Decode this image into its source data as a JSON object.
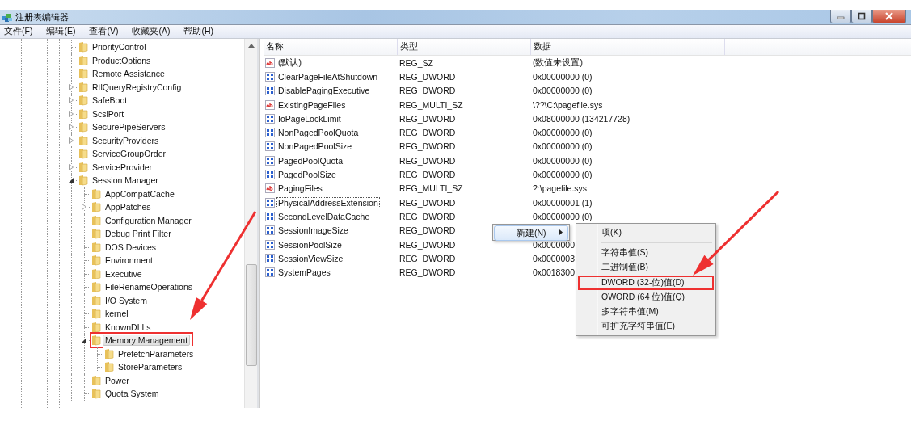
{
  "window": {
    "title": "注册表编辑器"
  },
  "menu_bar": [
    "文件(F)",
    "编辑(E)",
    "查看(V)",
    "收藏夹(A)",
    "帮助(H)"
  ],
  "tree": {
    "items": [
      {
        "label": "PriorityControl",
        "kind": "leaf",
        "selected": false,
        "marked": false
      },
      {
        "label": "ProductOptions",
        "kind": "leaf",
        "selected": false,
        "marked": false
      },
      {
        "label": "Remote Assistance",
        "kind": "leaf",
        "selected": false,
        "marked": false
      },
      {
        "label": "RtlQueryRegistryConfig",
        "kind": "collapsed",
        "selected": false,
        "marked": false
      },
      {
        "label": "SafeBoot",
        "kind": "collapsed",
        "selected": false,
        "marked": false
      },
      {
        "label": "ScsiPort",
        "kind": "collapsed",
        "selected": false,
        "marked": false
      },
      {
        "label": "SecurePipeServers",
        "kind": "collapsed",
        "selected": false,
        "marked": false
      },
      {
        "label": "SecurityProviders",
        "kind": "collapsed",
        "selected": false,
        "marked": false
      },
      {
        "label": "ServiceGroupOrder",
        "kind": "leaf",
        "selected": false,
        "marked": false
      },
      {
        "label": "ServiceProvider",
        "kind": "collapsed",
        "selected": false,
        "marked": false
      },
      {
        "label": "Session Manager",
        "kind": "expanded",
        "selected": false,
        "marked": false,
        "children": [
          {
            "label": "AppCompatCache",
            "kind": "leaf",
            "selected": false,
            "marked": false
          },
          {
            "label": "AppPatches",
            "kind": "collapsed",
            "selected": false,
            "marked": false
          },
          {
            "label": "Configuration Manager",
            "kind": "leaf",
            "selected": false,
            "marked": false
          },
          {
            "label": "Debug Print Filter",
            "kind": "leaf",
            "selected": false,
            "marked": false
          },
          {
            "label": "DOS Devices",
            "kind": "leaf",
            "selected": false,
            "marked": false
          },
          {
            "label": "Environment",
            "kind": "leaf",
            "selected": false,
            "marked": false
          },
          {
            "label": "Executive",
            "kind": "leaf",
            "selected": false,
            "marked": false
          },
          {
            "label": "FileRenameOperations",
            "kind": "leaf",
            "selected": false,
            "marked": false
          },
          {
            "label": "I/O System",
            "kind": "leaf",
            "selected": false,
            "marked": false
          },
          {
            "label": "kernel",
            "kind": "leaf",
            "selected": false,
            "marked": false
          },
          {
            "label": "KnownDLLs",
            "kind": "leaf",
            "selected": false,
            "marked": false
          },
          {
            "label": "Memory Management",
            "kind": "expanded",
            "selected": true,
            "marked": true,
            "children": [
              {
                "label": "PrefetchParameters",
                "kind": "leaf",
                "selected": false,
                "marked": false
              },
              {
                "label": "StoreParameters",
                "kind": "leaf",
                "selected": false,
                "marked": false
              }
            ]
          },
          {
            "label": "Power",
            "kind": "leaf",
            "selected": false,
            "marked": false
          },
          {
            "label": "Quota System",
            "kind": "leaf",
            "selected": false,
            "marked": false
          }
        ]
      }
    ]
  },
  "list": {
    "columns": [
      "名称",
      "类型",
      "数据"
    ],
    "rows": [
      {
        "name": "(默认)",
        "type": "REG_SZ",
        "data": "(数值未设置)",
        "kind": "string",
        "focused": false
      },
      {
        "name": "ClearPageFileAtShutdown",
        "type": "REG_DWORD",
        "data": "0x00000000 (0)",
        "kind": "dword",
        "focused": false
      },
      {
        "name": "DisablePagingExecutive",
        "type": "REG_DWORD",
        "data": "0x00000000 (0)",
        "kind": "dword",
        "focused": false
      },
      {
        "name": "ExistingPageFiles",
        "type": "REG_MULTI_SZ",
        "data": "\\??\\C:\\pagefile.sys",
        "kind": "string",
        "focused": false
      },
      {
        "name": "IoPageLockLimit",
        "type": "REG_DWORD",
        "data": "0x08000000 (134217728)",
        "kind": "dword",
        "focused": false
      },
      {
        "name": "NonPagedPoolQuota",
        "type": "REG_DWORD",
        "data": "0x00000000 (0)",
        "kind": "dword",
        "focused": false
      },
      {
        "name": "NonPagedPoolSize",
        "type": "REG_DWORD",
        "data": "0x00000000 (0)",
        "kind": "dword",
        "focused": false
      },
      {
        "name": "PagedPoolQuota",
        "type": "REG_DWORD",
        "data": "0x00000000 (0)",
        "kind": "dword",
        "focused": false
      },
      {
        "name": "PagedPoolSize",
        "type": "REG_DWORD",
        "data": "0x00000000 (0)",
        "kind": "dword",
        "focused": false
      },
      {
        "name": "PagingFiles",
        "type": "REG_MULTI_SZ",
        "data": "?:\\pagefile.sys",
        "kind": "string",
        "focused": false
      },
      {
        "name": "PhysicalAddressExtension",
        "type": "REG_DWORD",
        "data": "0x00000001 (1)",
        "kind": "dword",
        "focused": true
      },
      {
        "name": "SecondLevelDataCache",
        "type": "REG_DWORD",
        "data": "0x00000000 (0)",
        "kind": "dword",
        "focused": false
      },
      {
        "name": "SessionImageSize",
        "type": "REG_DWORD",
        "kind": "dword",
        "focused": false
      },
      {
        "name": "SessionPoolSize",
        "type": "REG_DWORD",
        "data": "0x0000000",
        "kind": "dword",
        "focused": false
      },
      {
        "name": "SessionViewSize",
        "type": "REG_DWORD",
        "data": "0x0000003",
        "kind": "dword",
        "focused": false
      },
      {
        "name": "SystemPages",
        "type": "REG_DWORD",
        "data": "0x0018300",
        "kind": "dword",
        "focused": false
      }
    ]
  },
  "context_menu": {
    "items": [
      {
        "label": "新建(N)",
        "selected": true
      }
    ]
  },
  "submenu": {
    "items": [
      {
        "kind": "item",
        "label": "项(K)",
        "marked": false
      },
      {
        "kind": "separator"
      },
      {
        "kind": "item",
        "label": "字符串值(S)",
        "marked": false
      },
      {
        "kind": "item",
        "label": "二进制值(B)",
        "marked": false
      },
      {
        "kind": "item",
        "label": "DWORD (32-位)值(D)",
        "marked": true
      },
      {
        "kind": "item",
        "label": "QWORD (64 位)值(Q)",
        "marked": false
      },
      {
        "kind": "item",
        "label": "多字符串值(M)",
        "marked": false
      },
      {
        "kind": "item",
        "label": "可扩充字符串值(E)",
        "marked": false
      }
    ]
  }
}
